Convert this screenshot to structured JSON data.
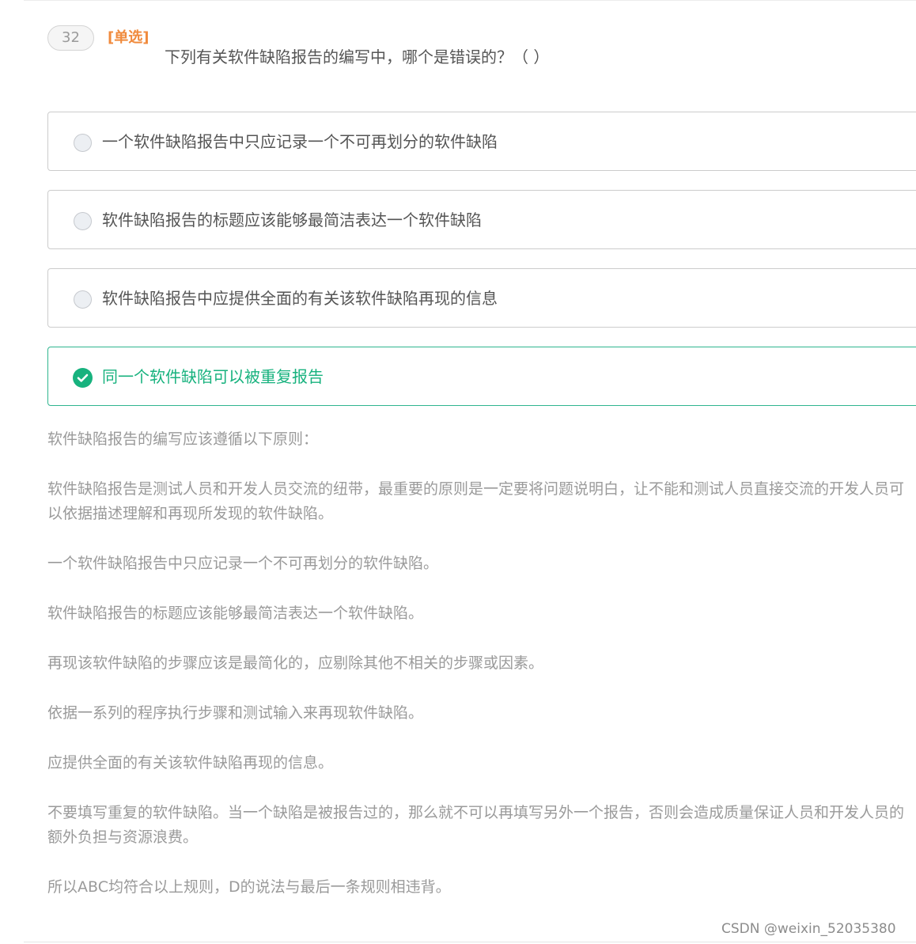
{
  "question": {
    "number": "32",
    "type_label": "[单选]",
    "text": "下列有关软件缺陷报告的编写中，哪个是错误的？（ ）"
  },
  "options": [
    {
      "label": "一个软件缺陷报告中只应记录一个不可再划分的软件缺陷",
      "selected": false
    },
    {
      "label": "软件缺陷报告的标题应该能够最简洁表达一个软件缺陷",
      "selected": false
    },
    {
      "label": "软件缺陷报告中应提供全面的有关该软件缺陷再现的信息",
      "selected": false
    },
    {
      "label": "同一个软件缺陷可以被重复报告",
      "selected": true
    }
  ],
  "explanation": [
    "软件缺陷报告的编写应该遵循以下原则：",
    "软件缺陷报告是测试人员和开发人员交流的纽带，最重要的原则是一定要将问题说明白，让不能和测试人员直接交流的开发人员可以依据描述理解和再现所发现的软件缺陷。",
    "一个软件缺陷报告中只应记录一个不可再划分的软件缺陷。",
    "软件缺陷报告的标题应该能够最简洁表达一个软件缺陷。",
    "再现该软件缺陷的步骤应该是最简化的，应剔除其他不相关的步骤或因素。",
    "依据一系列的程序执行步骤和测试输入来再现软件缺陷。",
    "应提供全面的有关该软件缺陷再现的信息。",
    "不要填写重复的软件缺陷。当一个缺陷是被报告过的，那么就不可以再填写另外一个报告，否则会造成质量保证人员和开发人员的额外负担与资源浪费。",
    "所以ABC均符合以上规则，D的说法与最后一条规则相违背。"
  ],
  "watermark": "CSDN @weixin_52035380",
  "colors": {
    "type_label": "#f08a3c",
    "correct": "#17b27e",
    "correct_border": "#2fb58f",
    "text": "#555555",
    "explanation": "#9a9a9a"
  },
  "icons": {
    "unselected": "radio-circle-icon",
    "selected": "check-circle-icon"
  }
}
